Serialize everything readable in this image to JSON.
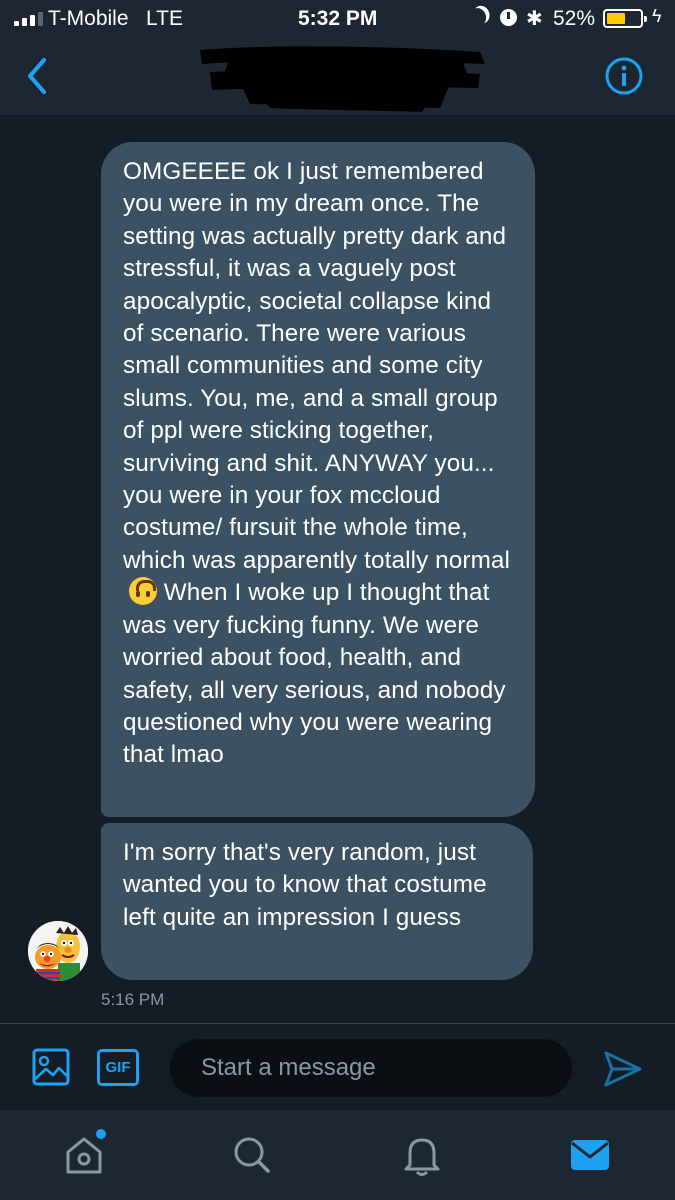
{
  "status_bar": {
    "carrier": "T-Mobile",
    "network": "LTE",
    "time": "5:32 PM",
    "battery_percent": "52%",
    "battery_level": 0.52
  },
  "header": {
    "back_icon": "chevron-left-icon",
    "info_icon": "info-circle-icon",
    "contact_name_redacted": true
  },
  "conversation": {
    "messages": [
      {
        "text": "OMGEEEE ok I just remembered you were in my dream once. The setting was actually pretty dark and stressful, it was a vaguely post apocalyptic, societal collapse kind of scenario. There were various small communities and some city slums. You, me, and a small group of ppl were sticking together, surviving and shit. ANYWAY you... you were in your fox mccloud costume/ fursuit the whole time, which was apparently totally normal",
        "text_after_emoji": "When I woke up I thought that was very fucking funny. We were worried about food, health, and safety, all very serious, and nobody questioned why you were wearing that lmao",
        "emoji": "upside-down-face"
      },
      {
        "text": "I'm sorry that's very random, just wanted you to know that costume left quite an impression I guess"
      }
    ],
    "timestamp": "5:16 PM"
  },
  "composer": {
    "placeholder": "Start a message",
    "gif_label": "GIF"
  },
  "tab_bar": {
    "items": [
      "home-icon",
      "search-icon",
      "notifications-icon",
      "messages-icon"
    ],
    "active": "messages-icon",
    "home_has_badge": true
  },
  "colors": {
    "background": "#141d26",
    "bar_background": "#1c2732",
    "bubble": "#3c5263",
    "accent": "#1da1f2",
    "muted_text": "#8899a6",
    "battery_fill": "#ffcc00"
  }
}
